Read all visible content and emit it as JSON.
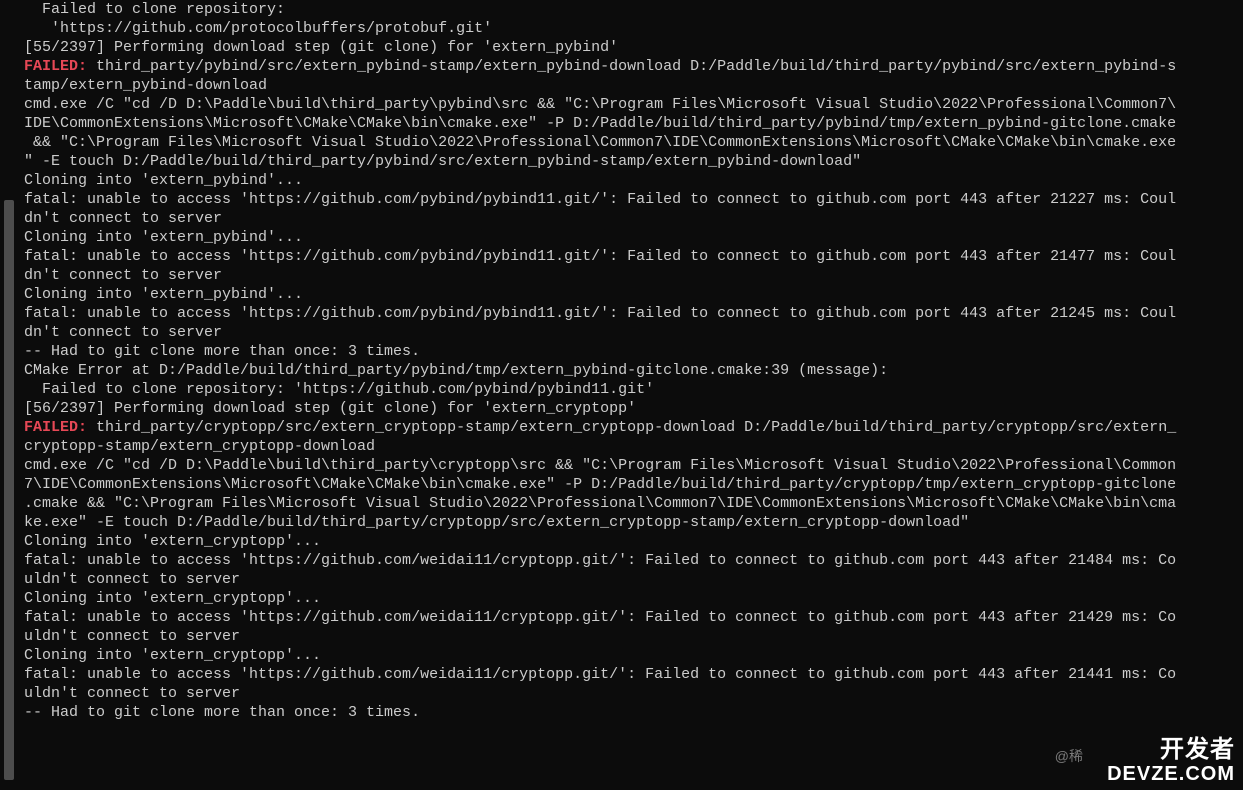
{
  "terminal": {
    "lines": [
      {
        "text": "  Failed to clone repository:"
      },
      {
        "text": "   'https://github.com/protocolbuffers/protobuf.git'"
      },
      {
        "text": ""
      },
      {
        "text": ""
      },
      {
        "text": "[55/2397] Performing download step (git clone) for 'extern_pybind'"
      },
      {
        "failed": "FAILED: ",
        "text": "third_party/pybind/src/extern_pybind-stamp/extern_pybind-download D:/Paddle/build/third_party/pybind/src/extern_pybind-stamp/extern_pybind-download"
      },
      {
        "text": "cmd.exe /C \"cd /D D:\\Paddle\\build\\third_party\\pybind\\src && \"C:\\Program Files\\Microsoft Visual Studio\\2022\\Professional\\Common7\\IDE\\CommonExtensions\\Microsoft\\CMake\\CMake\\bin\\cmake.exe\" -P D:/Paddle/build/third_party/pybind/tmp/extern_pybind-gitclone.cmake && \"C:\\Program Files\\Microsoft Visual Studio\\2022\\Professional\\Common7\\IDE\\CommonExtensions\\Microsoft\\CMake\\CMake\\bin\\cmake.exe\" -E touch D:/Paddle/build/third_party/pybind/src/extern_pybind-stamp/extern_pybind-download\""
      },
      {
        "text": "Cloning into 'extern_pybind'..."
      },
      {
        "text": "fatal: unable to access 'https://github.com/pybind/pybind11.git/': Failed to connect to github.com port 443 after 21227 ms: Couldn't connect to server"
      },
      {
        "text": "Cloning into 'extern_pybind'..."
      },
      {
        "text": "fatal: unable to access 'https://github.com/pybind/pybind11.git/': Failed to connect to github.com port 443 after 21477 ms: Couldn't connect to server"
      },
      {
        "text": "Cloning into 'extern_pybind'..."
      },
      {
        "text": "fatal: unable to access 'https://github.com/pybind/pybind11.git/': Failed to connect to github.com port 443 after 21245 ms: Couldn't connect to server"
      },
      {
        "text": "-- Had to git clone more than once: 3 times."
      },
      {
        "text": "CMake Error at D:/Paddle/build/third_party/pybind/tmp/extern_pybind-gitclone.cmake:39 (message):"
      },
      {
        "text": "  Failed to clone repository: 'https://github.com/pybind/pybind11.git'"
      },
      {
        "text": ""
      },
      {
        "text": ""
      },
      {
        "text": "[56/2397] Performing download step (git clone) for 'extern_cryptopp'"
      },
      {
        "failed": "FAILED: ",
        "text": "third_party/cryptopp/src/extern_cryptopp-stamp/extern_cryptopp-download D:/Paddle/build/third_party/cryptopp/src/extern_cryptopp-stamp/extern_cryptopp-download"
      },
      {
        "text": "cmd.exe /C \"cd /D D:\\Paddle\\build\\third_party\\cryptopp\\src && \"C:\\Program Files\\Microsoft Visual Studio\\2022\\Professional\\Common7\\IDE\\CommonExtensions\\Microsoft\\CMake\\CMake\\bin\\cmake.exe\" -P D:/Paddle/build/third_party/cryptopp/tmp/extern_cryptopp-gitclone.cmake && \"C:\\Program Files\\Microsoft Visual Studio\\2022\\Professional\\Common7\\IDE\\CommonExtensions\\Microsoft\\CMake\\CMake\\bin\\cmake.exe\" -E touch D:/Paddle/build/third_party/cryptopp/src/extern_cryptopp-stamp/extern_cryptopp-download\""
      },
      {
        "text": "Cloning into 'extern_cryptopp'..."
      },
      {
        "text": "fatal: unable to access 'https://github.com/weidai11/cryptopp.git/': Failed to connect to github.com port 443 after 21484 ms: Couldn't connect to server"
      },
      {
        "text": "Cloning into 'extern_cryptopp'..."
      },
      {
        "text": "fatal: unable to access 'https://github.com/weidai11/cryptopp.git/': Failed to connect to github.com port 443 after 21429 ms: Couldn't connect to server"
      },
      {
        "text": "Cloning into 'extern_cryptopp'..."
      },
      {
        "text": "fatal: unable to access 'https://github.com/weidai11/cryptopp.git/': Failed to connect to github.com port 443 after 21441 ms: Couldn't connect to server"
      },
      {
        "text": "-- Had to git clone more than once: 3 times."
      }
    ]
  },
  "watermark": {
    "at": "@稀",
    "top_cn": "开发者",
    "bottom": "DEVZE.COM"
  },
  "wrap_width": 128
}
